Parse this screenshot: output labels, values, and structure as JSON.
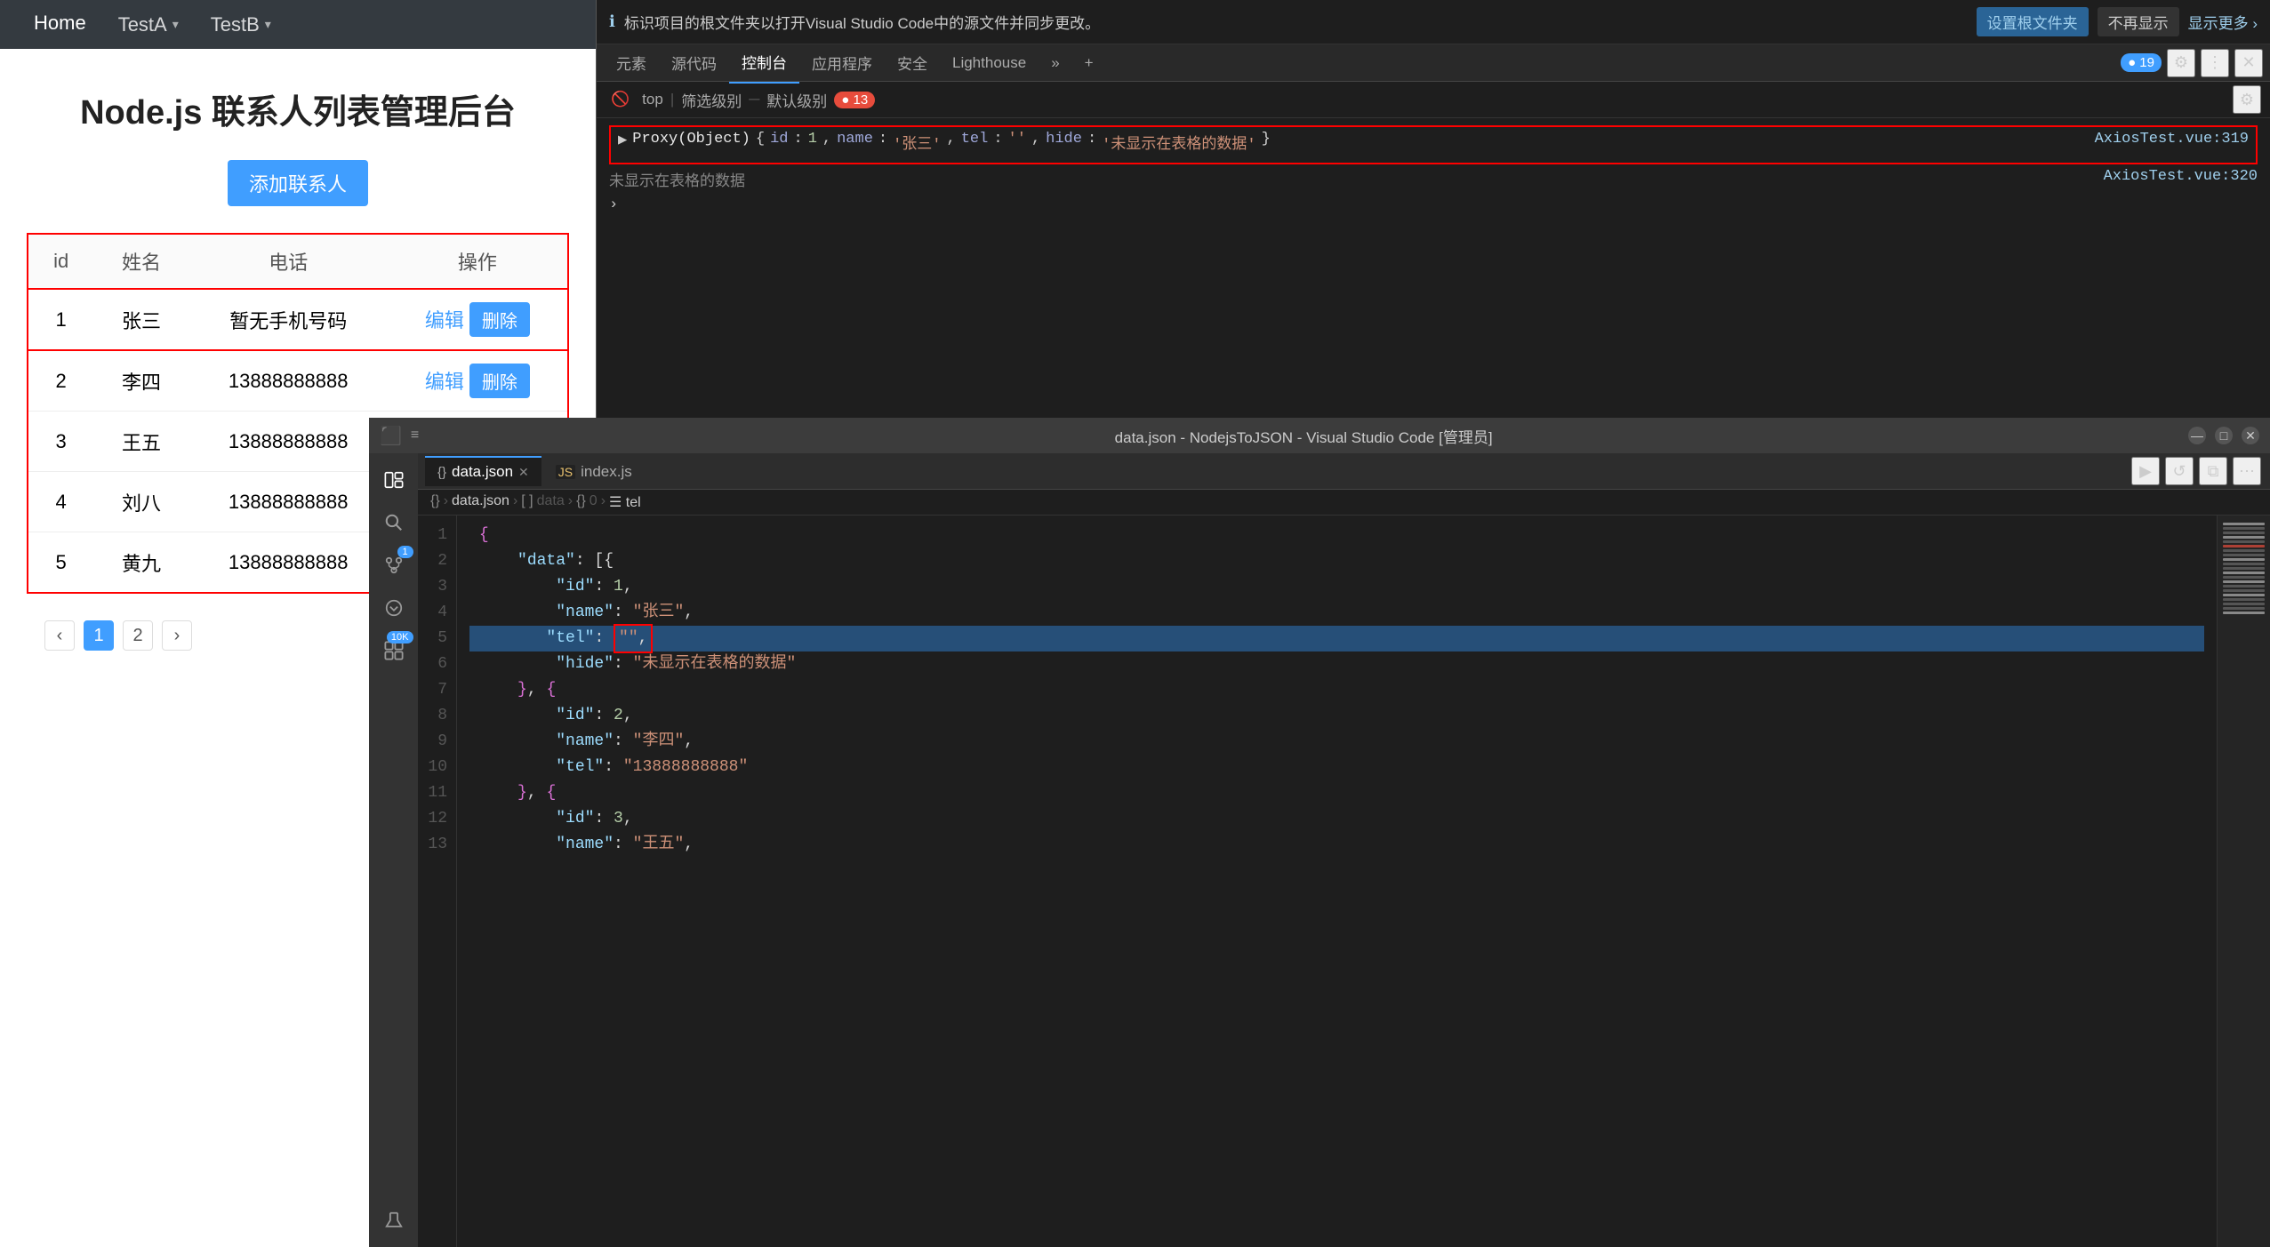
{
  "browser": {
    "tabs": [
      {
        "id": "home",
        "label": "Home",
        "active": true
      },
      {
        "id": "testA",
        "label": "TestA",
        "active": false,
        "hasChevron": true
      },
      {
        "id": "testB",
        "label": "TestB",
        "active": false,
        "hasChevron": true
      }
    ]
  },
  "page": {
    "title": "Node.js 联系人列表管理后台",
    "add_btn": "添加联系人",
    "table": {
      "headers": [
        "id",
        "姓名",
        "电话",
        "操作"
      ],
      "rows": [
        {
          "id": 1,
          "name": "张三",
          "tel": "暂无手机号码",
          "highlighted": true
        },
        {
          "id": 2,
          "name": "李四",
          "tel": "13888888888",
          "highlighted": false
        },
        {
          "id": 3,
          "name": "王五",
          "tel": "13888888888",
          "highlighted": false
        },
        {
          "id": 4,
          "name": "刘八",
          "tel": "13888888888",
          "highlighted": false
        },
        {
          "id": 5,
          "name": "黄九",
          "tel": "13888888888",
          "highlighted": false
        }
      ],
      "edit_label": "编辑",
      "delete_label": "删除"
    },
    "pagination": {
      "prev": "‹",
      "next": "›",
      "pages": [
        1,
        2
      ],
      "active_page": 1
    }
  },
  "devtools": {
    "banner": {
      "text": "标识项目的根文件夹以打开Visual Studio Code中的源文件并同步更改。",
      "setup_btn": "设置根文件夹",
      "dismiss_btn": "不再显示",
      "more_link": "显示更多 ›"
    },
    "tabs": [
      "元素",
      "源代码",
      "控制台",
      "应用程序",
      "安全",
      "Lighthouse"
    ],
    "active_tab": "控制台",
    "secondary_toolbar": {
      "filter_placeholder": "筛选级别",
      "default_val": "top",
      "count": "13"
    },
    "console": {
      "proxy_line": "▶ Proxy(Object) {id: 1, name: '张三', tel: '', hide: '未显示在表格的数据'}",
      "plain_line": "未显示在表格的数据",
      "link1": "AxiosTest.vue:319",
      "link2": "AxiosTest.vue:320",
      "expand_arrow": "›"
    }
  },
  "vscode": {
    "title": "data.json - NodejsToJSON - Visual Studio Code [管理员]",
    "tabs": [
      {
        "label": "data.json",
        "icon": "{}",
        "active": true,
        "closeable": true
      },
      {
        "label": "index.js",
        "icon": "JS",
        "active": false,
        "closeable": false
      }
    ],
    "breadcrumb": "json › {} data.json › [ ] data › {} 0 › ☰ tel",
    "code_lines": [
      {
        "num": 1,
        "content": "{",
        "highlight": false
      },
      {
        "num": 2,
        "content": "    \"data\": [{",
        "highlight": false
      },
      {
        "num": 3,
        "content": "        \"id\": 1,",
        "highlight": false
      },
      {
        "num": 4,
        "content": "        \"name\": \"张三\",",
        "highlight": false
      },
      {
        "num": 5,
        "content": "        \"tel\": \"\",",
        "highlight": true,
        "red_box": true
      },
      {
        "num": 6,
        "content": "        \"hide\": \"未显示在表格的数据\"",
        "highlight": false
      },
      {
        "num": 7,
        "content": "    }, {",
        "highlight": false
      },
      {
        "num": 8,
        "content": "        \"id\": 2,",
        "highlight": false
      },
      {
        "num": 9,
        "content": "        \"name\": \"李四\",",
        "highlight": false
      },
      {
        "num": 10,
        "content": "        \"tel\": \"13888888888\"",
        "highlight": false
      },
      {
        "num": 11,
        "content": "    }, {",
        "highlight": false
      },
      {
        "num": 12,
        "content": "        \"id\": 3,",
        "highlight": false
      },
      {
        "num": 13,
        "content": "        \"name\": \"王五\",",
        "highlight": false
      }
    ]
  }
}
